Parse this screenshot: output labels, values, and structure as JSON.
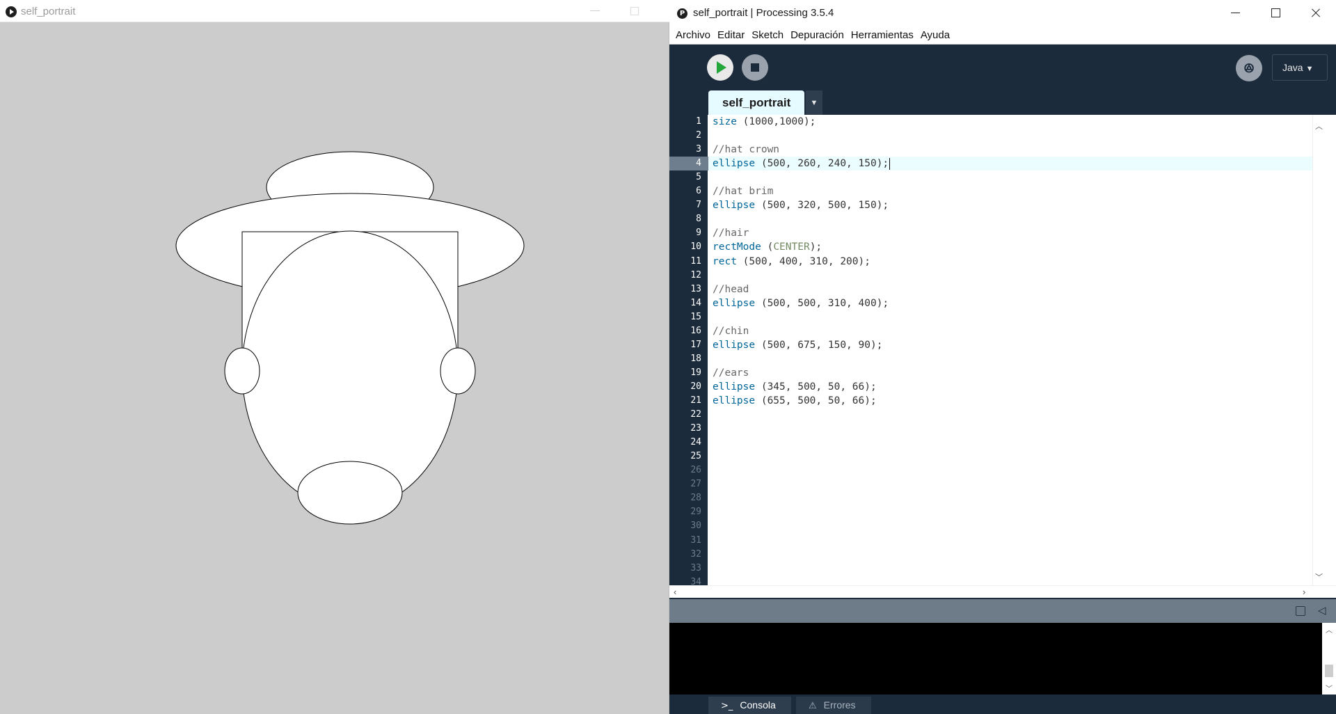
{
  "sketch_window": {
    "title": "self_portrait"
  },
  "ide": {
    "title": "self_portrait | Processing 3.5.4",
    "menu": [
      "Archivo",
      "Editar",
      "Sketch",
      "Depuración",
      "Herramientas",
      "Ayuda"
    ],
    "mode": "Java",
    "mode_caret": "▼",
    "tab_label": "self_portrait",
    "tab_menu": "▼",
    "current_line": 4,
    "code": [
      "size (1000,1000);",
      "",
      "//hat crown",
      "ellipse (500, 260, 240, 150);",
      "",
      "//hat brim",
      "ellipse (500, 320, 500, 150);",
      "",
      "//hair",
      "rectMode (CENTER);",
      "rect (500, 400, 310, 200);",
      "",
      "//head",
      "ellipse (500, 500, 310, 400);",
      "",
      "//chin",
      "ellipse (500, 675, 150, 90);",
      "",
      "//ears",
      "ellipse (345, 500, 50, 66);",
      "ellipse (655, 500, 50, 66);",
      "",
      "",
      "",
      "",
      "",
      "",
      "",
      "",
      "",
      "",
      "",
      "",
      ""
    ],
    "line_numbers": [
      "1",
      "2",
      "3",
      "4",
      "5",
      "6",
      "7",
      "8",
      "9",
      "10",
      "11",
      "12",
      "13",
      "14",
      "15",
      "16",
      "17",
      "18",
      "19",
      "20",
      "21",
      "22",
      "23",
      "24",
      "25",
      "26",
      "27",
      "28",
      "29",
      "30",
      "31",
      "32",
      "33",
      "34"
    ],
    "bottom_tabs": {
      "console": "Consola",
      "errors": "Errores"
    },
    "colors": {
      "keyword": "#006699",
      "comment": "#666666",
      "constant": "#718a62",
      "chrome": "#1b2b3b",
      "run_icon": "#23a63a"
    },
    "icons": [
      "run-icon",
      "stop-icon",
      "debugger-icon",
      "copy-icon",
      "collapse-icon",
      "terminal-icon",
      "warning-icon"
    ]
  }
}
